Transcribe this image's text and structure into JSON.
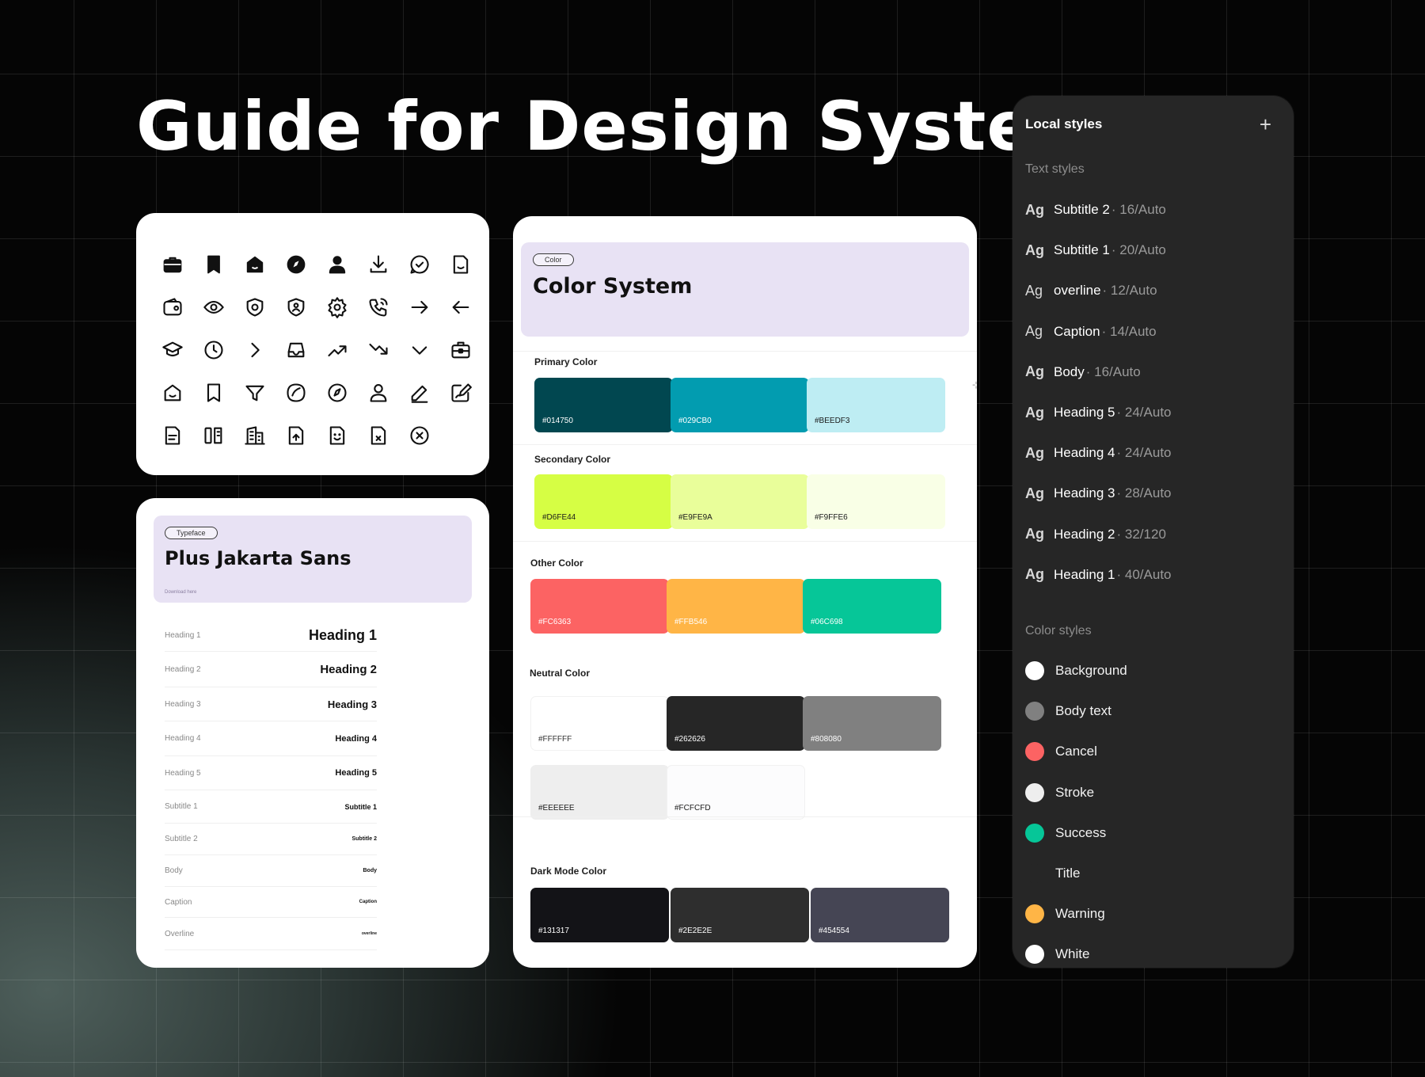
{
  "page": {
    "title": "Guide for Design System"
  },
  "icons": [
    "briefcase-icon",
    "bookmark-icon",
    "home-icon",
    "compass-icon",
    "user-icon",
    "download-icon",
    "chat-check-icon",
    "document-icon",
    "wallet-icon",
    "eye-icon",
    "shield-icon",
    "shield-user-icon",
    "settings-icon",
    "phone-call-icon",
    "arrow-right-icon",
    "arrow-left-icon",
    "graduation-cap-icon",
    "clock-icon",
    "chevron-right-icon",
    "inbox-icon",
    "trending-up-icon",
    "trending-down-icon",
    "chevron-down-icon",
    "briefcase-outline-icon",
    "home-outline-icon",
    "bookmark-outline-icon",
    "filter-icon",
    "shape-icon",
    "compass-outline-icon",
    "user-outline-icon",
    "pencil-icon",
    "edit-note-icon",
    "file-text-icon",
    "book-icon",
    "building-icon",
    "file-upload-icon",
    "file-smile-icon",
    "file-x-icon",
    "close-circle-icon"
  ],
  "typeface": {
    "pill": "Typeface",
    "name": "Plus Jakarta Sans",
    "link": "Download here",
    "rows": [
      {
        "label": "Heading 1",
        "spec": "Heading 1",
        "size": 18,
        "h": 40
      },
      {
        "label": "Heading 2",
        "spec": "Heading 2",
        "size": 15,
        "h": 45
      },
      {
        "label": "Heading 3",
        "spec": "Heading 3",
        "size": 13,
        "h": 43
      },
      {
        "label": "Heading 4",
        "spec": "Heading 4",
        "size": 11,
        "h": 44
      },
      {
        "label": "Heading 5",
        "spec": "Heading 5",
        "size": 11,
        "h": 43
      },
      {
        "label": "Subtitle 1",
        "spec": "Subtitle 1",
        "size": 9,
        "h": 42
      },
      {
        "label": "Subtitle 2",
        "spec": "Subtitle 2",
        "size": 7,
        "h": 40
      },
      {
        "label": "Body",
        "spec": "Body",
        "size": 7,
        "h": 40
      },
      {
        "label": "Caption",
        "spec": "Caption",
        "size": 6,
        "h": 39
      },
      {
        "label": "Overline",
        "spec": "overline",
        "size": 5,
        "h": 41
      }
    ]
  },
  "color_system": {
    "pill": "Color",
    "title": "Color System",
    "primary_label": "Primary Color",
    "secondary_label": "Secondary Color",
    "other_label": "Other Color",
    "neutral_label": "Neutral Color",
    "dark_label": "Dark Mode Color",
    "side_marker": "⊹",
    "swatches": {
      "primary": [
        {
          "hex": "#014750",
          "text": "#ffffff"
        },
        {
          "hex": "#029CB0",
          "text": "#ffffff"
        },
        {
          "hex": "#BEEDF3",
          "text": "#1a1a1a"
        }
      ],
      "secondary": [
        {
          "hex": "#D6FE44",
          "text": "#1a1a1a"
        },
        {
          "hex": "#E9FE9A",
          "text": "#1a1a1a"
        },
        {
          "hex": "#F9FFE6",
          "text": "#1a1a1a"
        }
      ],
      "other": [
        {
          "hex": "#FC6363",
          "text": "#ffffff"
        },
        {
          "hex": "#FFB546",
          "text": "#ffffff"
        },
        {
          "hex": "#06C698",
          "text": "#ffffff"
        }
      ],
      "neutral": [
        {
          "hex": "#FFFFFF",
          "text": "#333333"
        },
        {
          "hex": "#262626",
          "text": "#ffffff"
        },
        {
          "hex": "#808080",
          "text": "#ffffff"
        },
        {
          "hex": "#EEEEEE",
          "text": "#1a1a1a"
        },
        {
          "hex": "#FCFCFD",
          "text": "#1a1a1a"
        }
      ],
      "dark": [
        {
          "hex": "#131317",
          "text": "#ffffff"
        },
        {
          "hex": "#2E2E2E",
          "text": "#ffffff"
        },
        {
          "hex": "#454554",
          "text": "#ffffff"
        }
      ]
    }
  },
  "local_styles": {
    "title": "Local styles",
    "add_icon": "+",
    "text_styles_label": "Text styles",
    "ag": "Ag",
    "text_styles": [
      {
        "name": "Subtitle 2",
        "spec": "· 16/Auto"
      },
      {
        "name": "Subtitle 1",
        "spec": "· 20/Auto"
      },
      {
        "name": "overline",
        "spec": "· 12/Auto"
      },
      {
        "name": "Caption",
        "spec": "· 14/Auto"
      },
      {
        "name": "Body",
        "spec": "· 16/Auto"
      },
      {
        "name": "Heading 5",
        "spec": "· 24/Auto"
      },
      {
        "name": "Heading 4",
        "spec": "· 24/Auto"
      },
      {
        "name": "Heading 3",
        "spec": "· 28/Auto"
      },
      {
        "name": "Heading 2",
        "spec": "· 32/120"
      },
      {
        "name": "Heading 1",
        "spec": "· 40/Auto"
      }
    ],
    "color_styles_label": "Color styles",
    "color_styles": [
      {
        "name": "Background",
        "color": "#FFFFFF"
      },
      {
        "name": "Body text",
        "color": "#808080"
      },
      {
        "name": "Cancel",
        "color": "#FC6363"
      },
      {
        "name": "Stroke",
        "color": "#EEEEEE"
      },
      {
        "name": "Success",
        "color": "#06C698"
      },
      {
        "name": "Title",
        "color": "#262626"
      },
      {
        "name": "Warning",
        "color": "#FFB546"
      },
      {
        "name": "White",
        "color": "#FFFFFF"
      }
    ]
  }
}
